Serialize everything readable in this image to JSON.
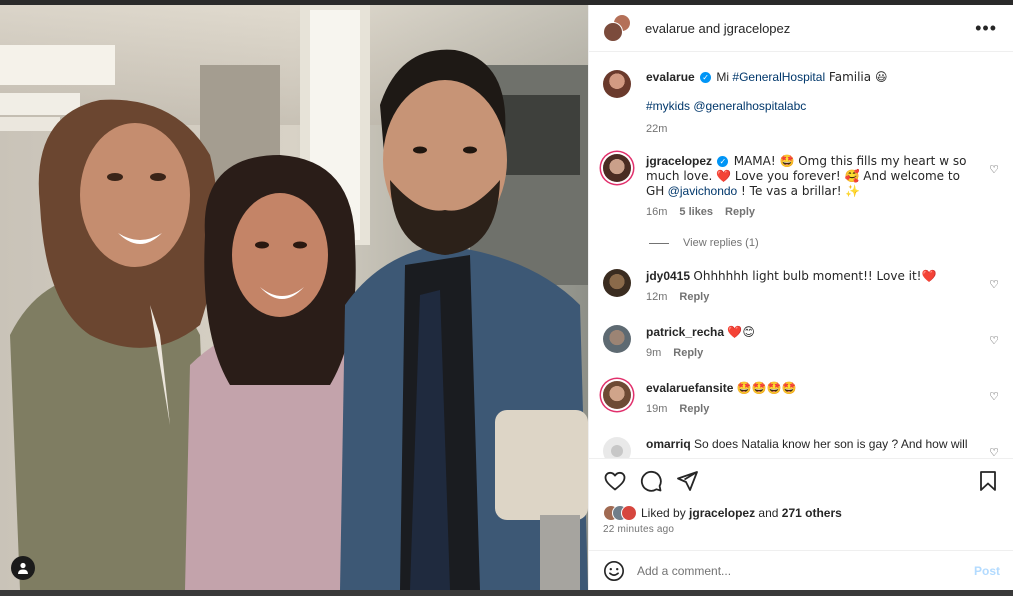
{
  "header": {
    "title": "evalarue and jgracelopez",
    "more_icon": "more-horizontal-icon"
  },
  "caption": {
    "username": "evalarue",
    "text_prefix": "Mi ",
    "hashtag": "#GeneralHospital",
    "text_suffix": " Familia 😃",
    "line2_tag1": "#mykids",
    "line2_tag2": "@generalhospitalabc",
    "time": "22m"
  },
  "comments": [
    {
      "username": "jgracelopez",
      "verified": true,
      "text1": "MAMA! 🤩 Omg this fills my heart w so much love. ❤️ Love you forever! 🥰 And welcome to GH",
      "mention": "@javichondo",
      "text2": " ! Te vas a brillar! ✨",
      "time": "16m",
      "likes": "5 likes",
      "reply": "Reply",
      "view_replies": "View replies (1)"
    },
    {
      "username": "jdy0415",
      "text1": "Ohhhhhh light bulb moment!! Love it!❤️",
      "time": "12m",
      "reply": "Reply"
    },
    {
      "username": "patrick_recha",
      "text1": "❤️😊",
      "time": "9m",
      "reply": "Reply"
    },
    {
      "username": "evalaruefansite",
      "text1": "🤩🤩🤩🤩",
      "time": "19m",
      "reply": "Reply"
    },
    {
      "username": "omarriq",
      "text1": "So does Natalia know her son is gay ? And how will"
    }
  ],
  "likes": {
    "prefix": "Liked by ",
    "user": "jgracelopez",
    "middle": " and ",
    "others": "271 others"
  },
  "time_ago": "22 minutes ago",
  "add_comment": {
    "placeholder": "Add a comment...",
    "post_label": "Post"
  },
  "colors": {
    "link": "#00376b",
    "verified": "#0095f6",
    "muted": "#737373",
    "post_disabled": "#b3dbff"
  }
}
